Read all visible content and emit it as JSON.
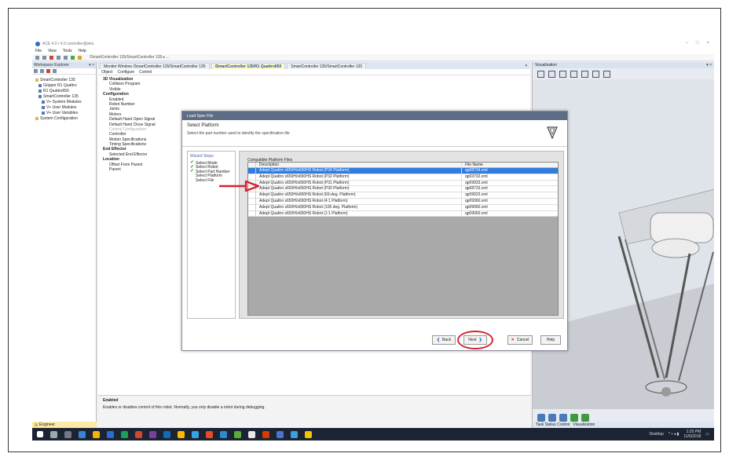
{
  "window": {
    "title": "ACE 4.0 / 4.0 controller@wks"
  },
  "menu": [
    "File",
    "View",
    "Tools",
    "Help"
  ],
  "toolbar": {
    "path": "/SmartController 135/SmartController 135 ▸ ..."
  },
  "workspace": {
    "title": "Workspace Explorer",
    "tree": [
      {
        "label": "SmartController 135",
        "indent": 1,
        "icon": "folder"
      },
      {
        "label": "Gripper R1 Quattro",
        "indent": 2,
        "icon": "item"
      },
      {
        "label": "R1 Quattro650",
        "indent": 2,
        "icon": "item"
      },
      {
        "label": "SmartController 135",
        "indent": 2,
        "icon": "item"
      },
      {
        "label": "V+ System Modules",
        "indent": 3,
        "icon": "item"
      },
      {
        "label": "V+ User Modules",
        "indent": 3,
        "icon": "item"
      },
      {
        "label": "V+ User Variables",
        "indent": 3,
        "icon": "item"
      },
      {
        "label": "System Configuration",
        "indent": 1,
        "icon": "folder"
      }
    ],
    "footer": "Engineer"
  },
  "tabs": [
    {
      "label": "Monitor Window /SmartController 135/SmartController 135",
      "active": false
    },
    {
      "label": "/SmartController 135/R1 Quattro650",
      "active": true
    },
    {
      "label": "SmartController 135/SmartController 135",
      "active": false
    }
  ],
  "subtabs": [
    "Object",
    "Configure",
    "Control"
  ],
  "properties": [
    {
      "label": "3D Visualization",
      "type": "cat"
    },
    {
      "label": "Collision Program",
      "type": "indent"
    },
    {
      "label": "Visible",
      "type": "indent"
    },
    {
      "label": "Configuration",
      "type": "cat"
    },
    {
      "label": "Enabled",
      "type": "indent"
    },
    {
      "label": "Robot Number",
      "type": "indent"
    },
    {
      "label": "Joints",
      "type": "indent"
    },
    {
      "label": "Motors",
      "type": "indent"
    },
    {
      "label": "Default Hand Open Signal",
      "type": "indent"
    },
    {
      "label": "Default Hand Close Signal",
      "type": "indent"
    },
    {
      "label": "Control Configuration",
      "type": "dim"
    },
    {
      "label": "Controller",
      "type": "indent"
    },
    {
      "label": "Motion Specifications",
      "type": "indent"
    },
    {
      "label": "Timing Specifications",
      "type": "indent"
    },
    {
      "label": "End Effector",
      "type": "cat"
    },
    {
      "label": "Selected End Effector",
      "type": "indent"
    },
    {
      "label": "Location",
      "type": "cat"
    },
    {
      "label": "Offset From Parent",
      "type": "indent"
    },
    {
      "label": "Parent",
      "type": "indent"
    }
  ],
  "help": {
    "heading": "Enabled",
    "text": "Enables or disables control of this robot. Normally, you only disable a robot during debugging."
  },
  "viz": {
    "title": "Visualization",
    "tabs": [
      "Task Status Control",
      "Visualization"
    ]
  },
  "dialog": {
    "title": "Load Spec File",
    "heading": "Select Platform",
    "subheading": "Select the part number used to identify the specification file",
    "wizard_title": "Wizard Steps",
    "steps": [
      {
        "label": "Select Mode",
        "done": true
      },
      {
        "label": "Select Robot",
        "done": true
      },
      {
        "label": "Select Part Number",
        "done": true
      },
      {
        "label": "Select Platform",
        "done": false
      },
      {
        "label": "Select File",
        "done": false
      }
    ],
    "list_caption": "Compatible Platform Files",
    "columns": [
      "Description",
      "File Name"
    ],
    "rows": [
      {
        "description": "Adept Quattro s650H/s650HS Robot (P34 Platform)",
        "file": "qp08734.xml",
        "selected": true
      },
      {
        "description": "Adept Quattro s650H/s650HS Robot (P32 Platform)",
        "file": "qp03732.xml",
        "selected": false
      },
      {
        "description": "Adept Quattro s650H/s650HS Robot (P31 Platform)",
        "file": "qp09933.xml",
        "selected": false
      },
      {
        "description": "Adept Quattro s650H/s650HS Robot (P30 Platform)",
        "file": "qp08733.xml",
        "selected": false
      },
      {
        "description": "Adept Quattro s650H/s650HS Robot (60-deg. Platform)",
        "file": "qp09023.xml",
        "selected": false
      },
      {
        "description": "Adept Quattro s650H/s650HS Robot (4:1 Platform)",
        "file": "qp09360.xml",
        "selected": false
      },
      {
        "description": "Adept Quattro s650H/s650HS Robot (105 deg. Platform)",
        "file": "qp09060.xml",
        "selected": false
      },
      {
        "description": "Adept Quattro s650H/s650HS Robot (1:1 Platform)",
        "file": "qp09060.xml",
        "selected": false
      }
    ],
    "buttons": {
      "back": "Back",
      "next": "Next",
      "cancel": "Cancel",
      "help": "Help"
    }
  },
  "taskbar": {
    "time": "1:25 PM",
    "date": "11/5/2018",
    "desktop": "Desktop"
  },
  "colors": {
    "highlight": "#d6222f",
    "selection": "#2f7de1",
    "dialog_title": "#5c6d85"
  }
}
